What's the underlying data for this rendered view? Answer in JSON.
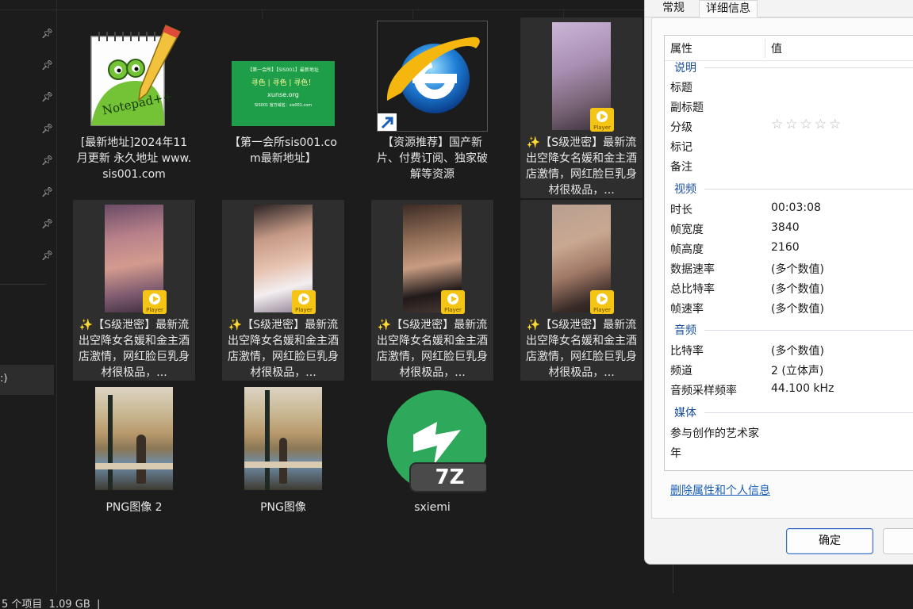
{
  "explorer": {
    "drive_label": ":)",
    "status_count": "5 个项目",
    "status_size": "1.09 GB",
    "status_cursor": "|",
    "items": [
      {
        "label": "[最新地址]2024年11月更新 永久地址 www.sis001.com",
        "icon": "notepad-plus-plus-icon"
      },
      {
        "label": "【第一会所sis001.com最新地址】",
        "icon": "image-thumbnail"
      },
      {
        "label": "【资源推荐】国产新片、付费订阅、独家破解等资源",
        "icon": "internet-explorer-shortcut-icon"
      },
      {
        "label": "✨【S级泄密】最新流出空降女名媛和金主酒店激情，网红脸巨乳身材很极品，...",
        "icon": "video-thumbnail",
        "badge": "Player"
      },
      {
        "label": "✨【S级泄密】最新流出空降女名媛和金主酒店激情，网红脸巨乳身材很极品，...",
        "icon": "video-thumbnail",
        "badge": "Player"
      },
      {
        "label": "✨【S级泄密】最新流出空降女名媛和金主酒店激情，网红脸巨乳身材很极品，...",
        "icon": "video-thumbnail",
        "badge": "Player"
      },
      {
        "label": "✨【S级泄密】最新流出空降女名媛和金主酒店激情，网红脸巨乳身材很极品，...",
        "icon": "video-thumbnail",
        "badge": "Player"
      },
      {
        "label": "✨【S级泄密】最新流出空降女名媛和金主酒店激情，网红脸巨乳身材很极品，...",
        "icon": "video-thumbnail",
        "badge": "Player"
      },
      {
        "label": "PNG图像 2",
        "icon": "image-thumbnail"
      },
      {
        "label": "PNG图像",
        "icon": "image-thumbnail"
      },
      {
        "label": "sxiemi",
        "icon": "7z-archive-icon",
        "badge": "7Z"
      }
    ],
    "green_card": {
      "line1": "【第一会所】【SIS001】最新地址",
      "line2": "寻色 | 寻色 | 寻色！",
      "line3": "xunse.org",
      "line4": "SIS001 官方域名：sis001.com"
    }
  },
  "dialog": {
    "tabs": [
      "常规",
      "详细信息"
    ],
    "active_tab": "详细信息",
    "col_property": "属性",
    "col_value": "值",
    "groups": [
      {
        "name": "说明",
        "rows": [
          {
            "prop": "标题",
            "value": ""
          },
          {
            "prop": "副标题",
            "value": ""
          },
          {
            "prop": "分级",
            "value": "☆☆☆☆☆"
          },
          {
            "prop": "标记",
            "value": ""
          },
          {
            "prop": "备注",
            "value": ""
          }
        ]
      },
      {
        "name": "视频",
        "rows": [
          {
            "prop": "时长",
            "value": "00:03:08"
          },
          {
            "prop": "帧宽度",
            "value": "3840"
          },
          {
            "prop": "帧高度",
            "value": "2160"
          },
          {
            "prop": "数据速率",
            "value": "(多个数值)"
          },
          {
            "prop": "总比特率",
            "value": "(多个数值)"
          },
          {
            "prop": "帧速率",
            "value": "(多个数值)"
          }
        ]
      },
      {
        "name": "音频",
        "rows": [
          {
            "prop": "比特率",
            "value": "(多个数值)"
          },
          {
            "prop": "频道",
            "value": "2 (立体声)"
          },
          {
            "prop": "音频采样频率",
            "value": "44.100 kHz"
          }
        ]
      },
      {
        "name": "媒体",
        "rows": [
          {
            "prop": "参与创作的艺术家",
            "value": ""
          },
          {
            "prop": "年",
            "value": ""
          }
        ]
      }
    ],
    "remove_link": "删除属性和个人信息",
    "ok_button": "确定",
    "cancel_button": ""
  },
  "colors": {
    "explorer_bg": "#1c1c1c",
    "dialog_bg": "#f3f3f3",
    "link": "#1a5fb4",
    "group_header": "#1a4f9c",
    "player_badge": "#f4c514"
  }
}
